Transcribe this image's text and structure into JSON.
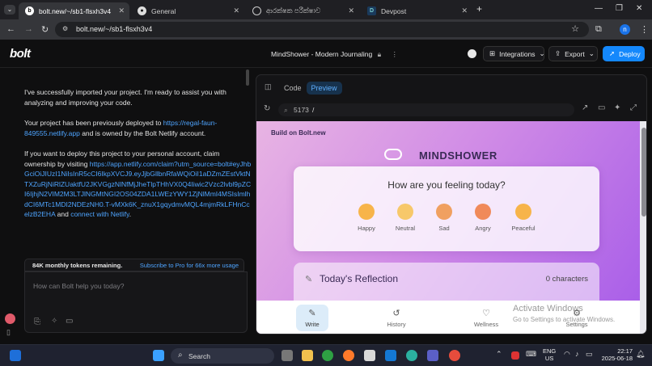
{
  "browser": {
    "tabs": [
      {
        "title": "bolt.new/~/sb1-flsxh3v4",
        "active": true
      },
      {
        "title": "General",
        "active": false
      },
      {
        "title": "ආරක්ෂක පරීක්ෂාව",
        "active": false
      },
      {
        "title": "Devpost",
        "active": false
      }
    ],
    "url": "bolt.new/~/sb1-flsxh3v4",
    "profile_initial": "n"
  },
  "bolt": {
    "logo": "bolt",
    "project_title": "MindShower - Modern Journaling",
    "integrations_label": "Integrations",
    "export_label": "Export",
    "deploy_label": "Deploy"
  },
  "chat": {
    "msg1": "I've successfully imported your project. I'm ready to assist you with analyzing and improving your code.",
    "msg2_prefix": "Your project has been previously deployed to ",
    "msg2_link": "https://regal-faun-849555.netlify.app",
    "msg2_suffix": " and is owned by the Bolt Netlify account.",
    "msg3_prefix": "If you want to deploy this project to your personal account, claim ownership by visiting ",
    "msg3_link": "https://app.netlify.com/claim?utm_source=bolt#eyJhbGciOiJIUzI1NiIsInR5cCI6IkpXVCJ9.eyJjbGllbnRfaWQiOiI1aDZmZEstVktNTXZuRjNiRlZUaktfU2JKVGgzNlNfMjJheTlpTHhVX0Q4Iiwic2Vzc2lvbl9pZCI6IjhjN2VIM2M3LTJlNGMtNGI2OS04ZDA1LWEzYWY1ZjNlMmI4MSIsImlhdCI6MTc1MDI2NDEzNH0.T-vMXk6K_znuX1gqydmvMQL4mjmRkLFHnCcelzB2EHA",
    "msg3_mid": " and ",
    "msg3_link2": "connect with Netlify",
    "msg3_end": ".",
    "tokens_remaining": "84K monthly tokens remaining.",
    "subscribe": "Subscribe to Pro for 66x more usage",
    "prompt_placeholder": "How can Bolt help you today?"
  },
  "preview": {
    "tab_code": "Code",
    "tab_preview": "Preview",
    "port": "5173",
    "path": "/"
  },
  "site": {
    "badge": "Build on Bolt.new",
    "brand": "MINDSHOWER",
    "question": "How are you feeling today?",
    "moods": [
      {
        "label": "Happy",
        "color": "#f7b44a"
      },
      {
        "label": "Neutral",
        "color": "#f7c86a"
      },
      {
        "label": "Sad",
        "color": "#f0a060"
      },
      {
        "label": "Angry",
        "color": "#f08a5a"
      },
      {
        "label": "Peaceful",
        "color": "#f7b44a"
      }
    ],
    "reflection_title": "Today's Reflection",
    "char_count": "0 characters",
    "nav": [
      {
        "label": "Write",
        "icon": "pencil-icon",
        "active": true
      },
      {
        "label": "History",
        "icon": "history-icon",
        "active": false
      },
      {
        "label": "Wellness",
        "icon": "heart-icon",
        "active": false
      },
      {
        "label": "Settings",
        "icon": "gear-icon",
        "active": false
      }
    ],
    "watermark_line1": "Activate Windows",
    "watermark_line2": "Go to Settings to activate Windows."
  },
  "taskbar": {
    "search_label": "Search",
    "lang1": "ENG",
    "lang2": "US",
    "time": "22:17",
    "date": "2025-06-18"
  }
}
